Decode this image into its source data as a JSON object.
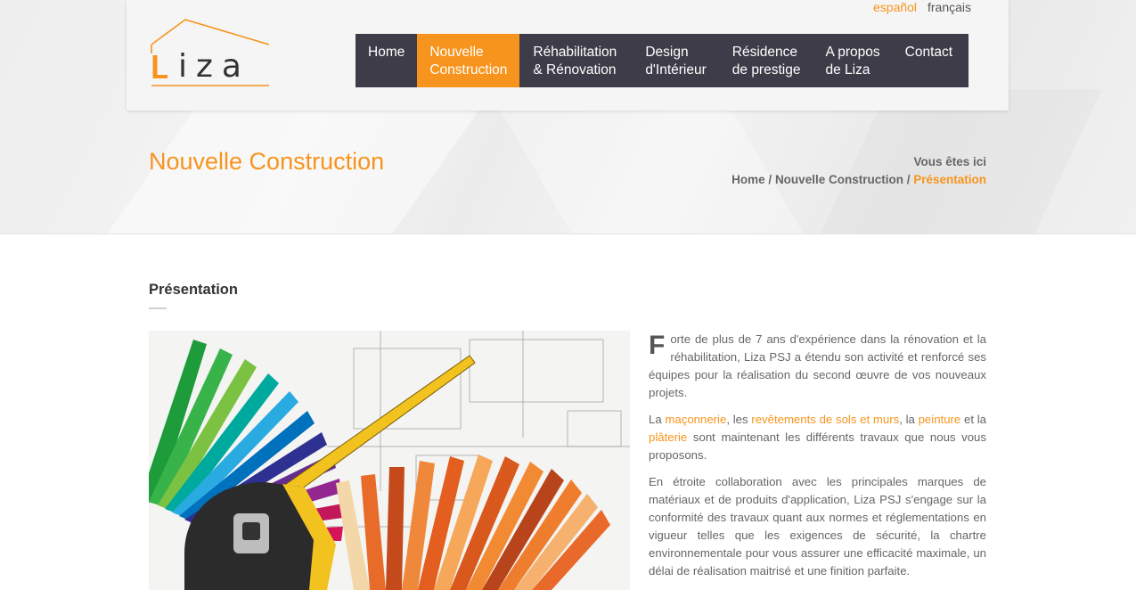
{
  "header": {
    "logo_text": "Liza",
    "languages": [
      {
        "label": "español",
        "color": "#f7941d"
      },
      {
        "label": "français"
      }
    ]
  },
  "nav": [
    {
      "label": "Home"
    },
    {
      "label": "Nouvelle\nConstruction",
      "active": true
    },
    {
      "label": "Réhabilitation\n& Rénovation"
    },
    {
      "label": "Design\nd'Intérieur"
    },
    {
      "label": "Résidence\nde prestige"
    },
    {
      "label": "A propos\nde Liza"
    },
    {
      "label": "Contact"
    }
  ],
  "page": {
    "title": "Nouvelle Construction",
    "you_are_here": "Vous êtes ici",
    "breadcrumb": {
      "home": "Home",
      "sep": " / ",
      "parent": "Nouvelle Construction",
      "current": "Présentation"
    }
  },
  "section": {
    "title": "Présentation",
    "p1_dropcap": "F",
    "p1_rest": "orte de plus de 7 ans d'expérience dans la rénovation et la réhabilitation, Liza PSJ a étendu son activité et renforcé ses équipes pour la réalisation du second œuvre de vos nouveaux projets.",
    "p2": {
      "t1": "La ",
      "l1": "maçonnerie",
      "t2": ", les ",
      "l2": "revêtements de sols et murs",
      "t3": ", la ",
      "l3": "peinture",
      "t4": " et la ",
      "l4": "plâterie",
      "t5": " sont maintenant les différents travaux que nous vous proposons."
    },
    "p3": "En étroite collaboration avec les principales marques de matériaux et de produits d'application, Liza PSJ s'engage sur la conformité des travaux quant aux normes et réglementations en vigueur telles que les exigences de sécurité, la chartre environnementale pour vous assurer une efficacité maximale, un délai de réalisation maitrisé et une finition parfaite."
  },
  "colors": {
    "accent": "#f7941d",
    "nav_bg": "#3d3c48"
  },
  "icons": {
    "logo": "house-roof-logo-icon",
    "photo": "color-swatch-tape-measure-image"
  }
}
